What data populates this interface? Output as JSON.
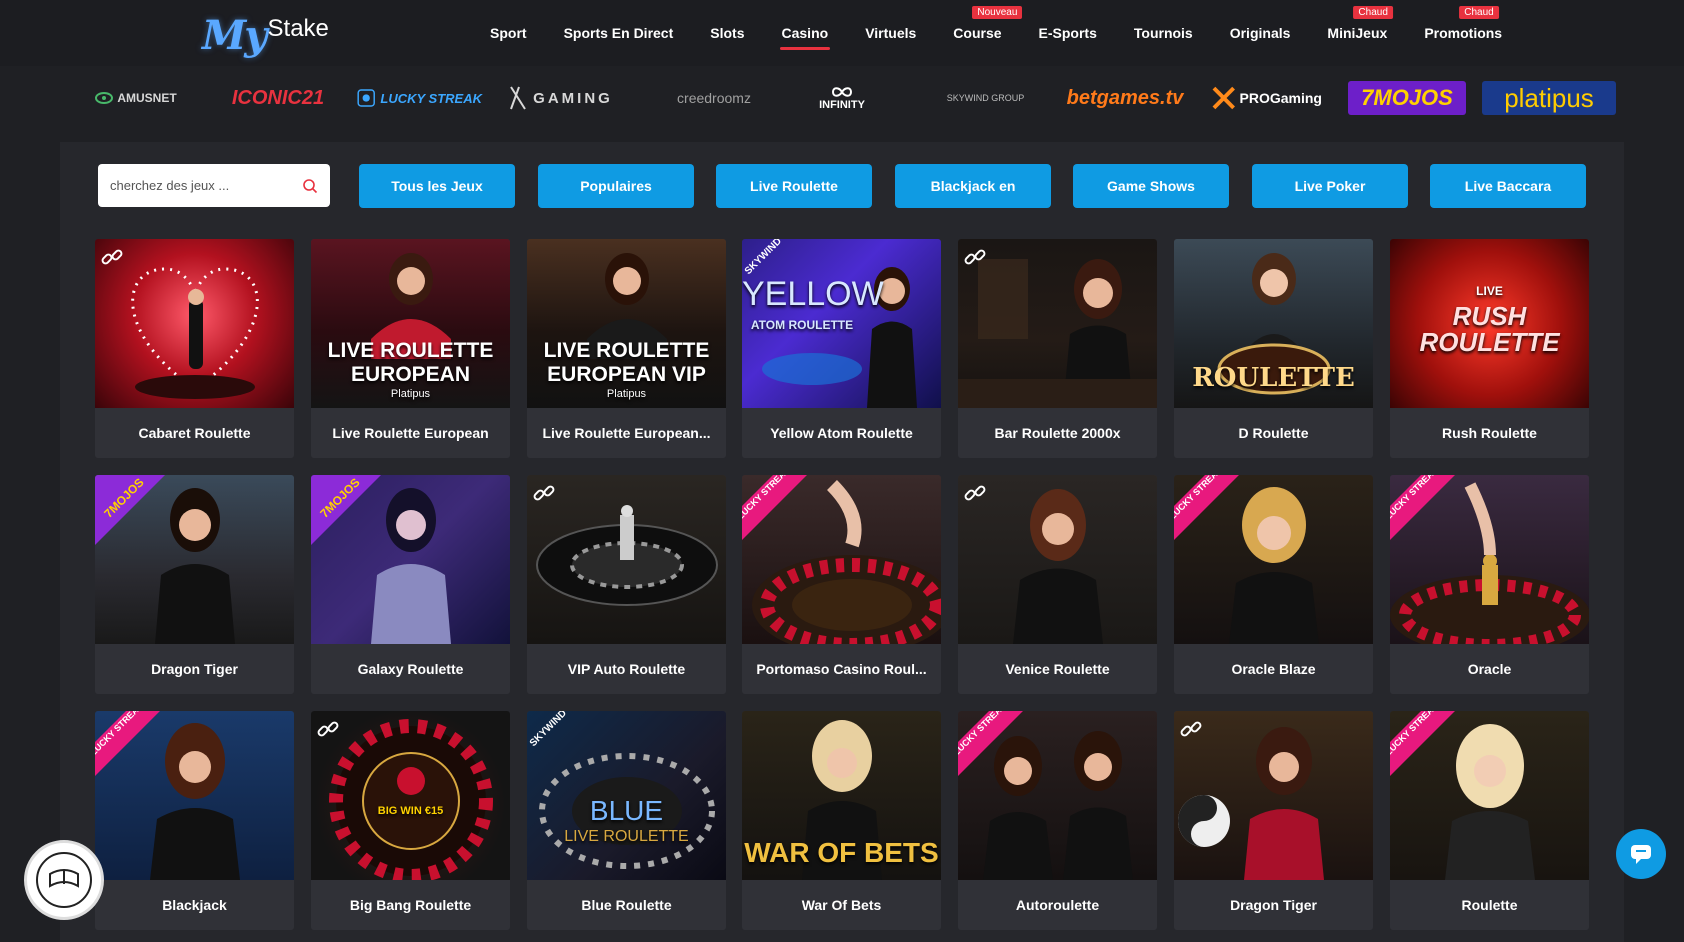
{
  "logo": {
    "part1": "My",
    "part2": "Stake"
  },
  "nav": [
    {
      "label": "Sport",
      "badge": ""
    },
    {
      "label": "Sports En Direct",
      "badge": ""
    },
    {
      "label": "Slots",
      "badge": ""
    },
    {
      "label": "Casino",
      "badge": "",
      "active": true
    },
    {
      "label": "Virtuels",
      "badge": ""
    },
    {
      "label": "Course",
      "badge": "Nouveau"
    },
    {
      "label": "E-Sports",
      "badge": ""
    },
    {
      "label": "Tournois",
      "badge": ""
    },
    {
      "label": "Originals",
      "badge": ""
    },
    {
      "label": "MiniJeux",
      "badge": "Chaud"
    },
    {
      "label": "Promotions",
      "badge": "Chaud"
    }
  ],
  "providers": [
    "AMUSNET",
    "ICONIC21",
    "LUCKY STREAK",
    "GAMING",
    "creedroomz",
    "INFINITY",
    "SKYWIND GROUP",
    "betgames.tv",
    "PROGaming",
    "7MOJOS",
    "platipus"
  ],
  "search": {
    "placeholder": "cherchez des jeux ..."
  },
  "categories": [
    "Tous les Jeux",
    "Populaires",
    "Live Roulette",
    "Blackjack en",
    "Game Shows",
    "Live Poker",
    "Live Baccara"
  ],
  "games": [
    {
      "title": "Cabaret Roulette",
      "thumb_text": ""
    },
    {
      "title": "Live Roulette European",
      "thumb_text": "LIVE ROULETTE EUROPEAN",
      "thumb_sub": "Platipus"
    },
    {
      "title": "Live Roulette European...",
      "thumb_text": "LIVE ROULETTE EUROPEAN VIP",
      "thumb_sub": "Platipus"
    },
    {
      "title": "Yellow Atom Roulette",
      "thumb_text": "YELLOW",
      "thumb_sub": "ATOM ROULETTE"
    },
    {
      "title": "Bar Roulette 2000x",
      "thumb_text": ""
    },
    {
      "title": "D Roulette",
      "thumb_text": "ROULETTE"
    },
    {
      "title": "Rush Roulette",
      "thumb_text": "RUSH ROULETTE",
      "thumb_sub": "LIVE"
    },
    {
      "title": "Dragon Tiger",
      "thumb_text": ""
    },
    {
      "title": "Galaxy Roulette",
      "thumb_text": ""
    },
    {
      "title": "VIP Auto Roulette",
      "thumb_text": ""
    },
    {
      "title": "Portomaso Casino Roul...",
      "thumb_text": ""
    },
    {
      "title": "Venice Roulette",
      "thumb_text": ""
    },
    {
      "title": "Oracle Blaze",
      "thumb_text": ""
    },
    {
      "title": "Oracle",
      "thumb_text": ""
    },
    {
      "title": "Blackjack",
      "thumb_text": ""
    },
    {
      "title": "Big Bang Roulette",
      "thumb_text": "BIG WIN €15"
    },
    {
      "title": "Blue Roulette",
      "thumb_text": "BLUE",
      "thumb_sub": "LIVE ROULETTE"
    },
    {
      "title": "War Of Bets",
      "thumb_text": "WAR OF BETS"
    },
    {
      "title": "Autoroulette",
      "thumb_text": ""
    },
    {
      "title": "Dragon Tiger",
      "thumb_text": ""
    },
    {
      "title": "Roulette",
      "thumb_text": ""
    }
  ],
  "badges": {
    "lucky_streak": "LUCKY STREAK",
    "mojos": "7MOJOS",
    "skywind": "SKYWIND"
  },
  "colors": {
    "accent": "#0f9be3",
    "badge": "#e8323f",
    "bg": "#1f2024",
    "panel": "#26272c",
    "card": "#303137"
  }
}
